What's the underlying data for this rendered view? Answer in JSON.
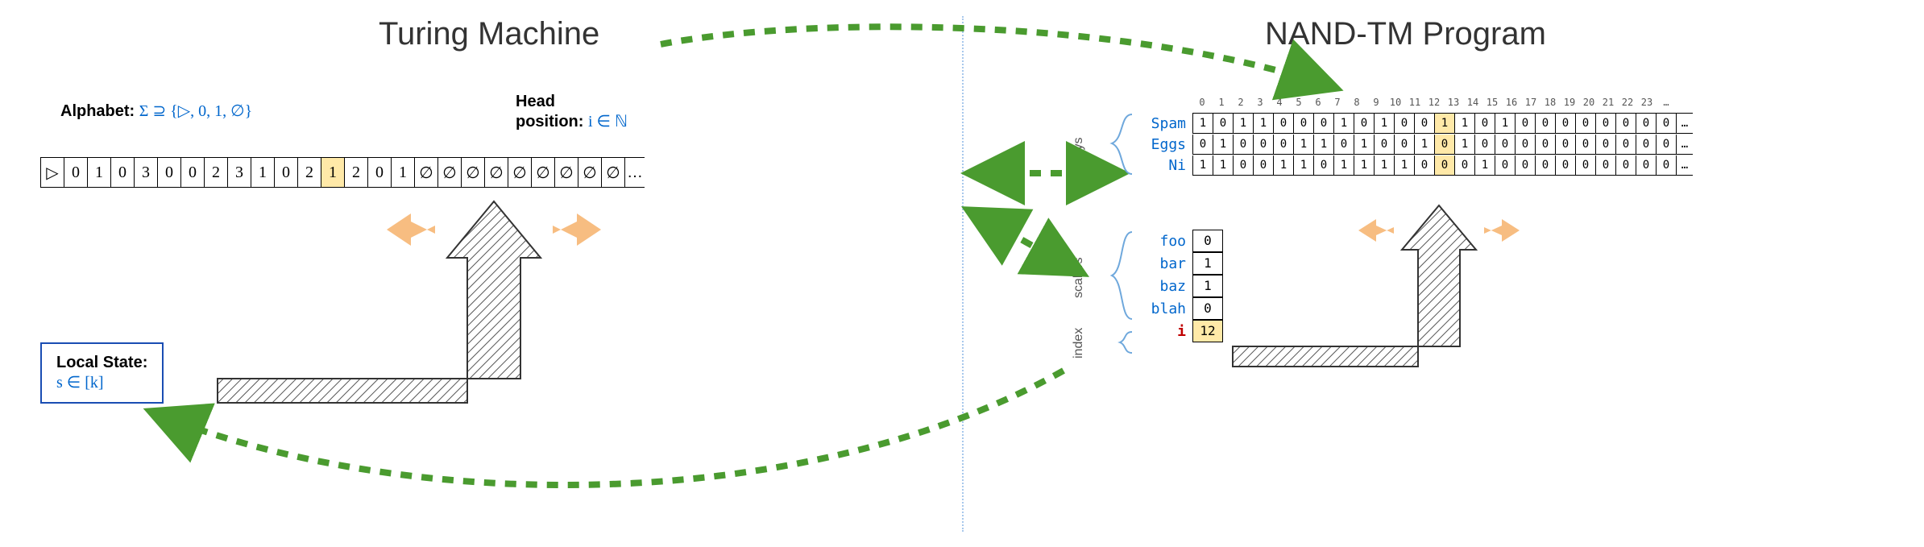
{
  "left": {
    "title": "Turing Machine",
    "alphabet_label": "Alphabet:",
    "alphabet_math": "Σ ⊇ {▷, 0, 1, ∅}",
    "head_label1": "Head",
    "head_label2": "position:",
    "head_math": "i ∈ ℕ",
    "tape": [
      "▷",
      "0",
      "1",
      "0",
      "3",
      "0",
      "0",
      "2",
      "3",
      "1",
      "0",
      "2",
      "1",
      "2",
      "0",
      "1",
      "∅",
      "∅",
      "∅",
      "∅",
      "∅",
      "∅",
      "∅",
      "∅",
      "∅"
    ],
    "tape_dots": "…",
    "highlight_index": 12,
    "local_state_label": "Local State:",
    "local_state_math": "s ∈ [k]"
  },
  "right": {
    "title": "NAND-TM Program",
    "col_count": 24,
    "col_dots": "…",
    "highlight_col": 12,
    "arrays_label": "arrays",
    "arrays": [
      {
        "name": "Spam",
        "cells": [
          1,
          0,
          1,
          1,
          0,
          0,
          0,
          1,
          0,
          1,
          0,
          0,
          1,
          1,
          0,
          1,
          0,
          0,
          0,
          0,
          0,
          0,
          0,
          0
        ]
      },
      {
        "name": "Eggs",
        "cells": [
          0,
          1,
          0,
          0,
          0,
          1,
          1,
          0,
          1,
          0,
          0,
          1,
          0,
          1,
          0,
          0,
          0,
          0,
          0,
          0,
          0,
          0,
          0,
          0
        ]
      },
      {
        "name": "Ni",
        "cells": [
          1,
          1,
          0,
          0,
          1,
          1,
          0,
          1,
          1,
          1,
          1,
          0,
          0,
          0,
          1,
          0,
          0,
          0,
          0,
          0,
          0,
          0,
          0,
          0
        ]
      }
    ],
    "scalars_label": "scalars",
    "scalars": [
      {
        "name": "foo",
        "value": 0
      },
      {
        "name": "bar",
        "value": 1
      },
      {
        "name": "baz",
        "value": 1
      },
      {
        "name": "blah",
        "value": 0
      }
    ],
    "index_label": "index",
    "index": {
      "name": "i",
      "value": 12
    }
  }
}
